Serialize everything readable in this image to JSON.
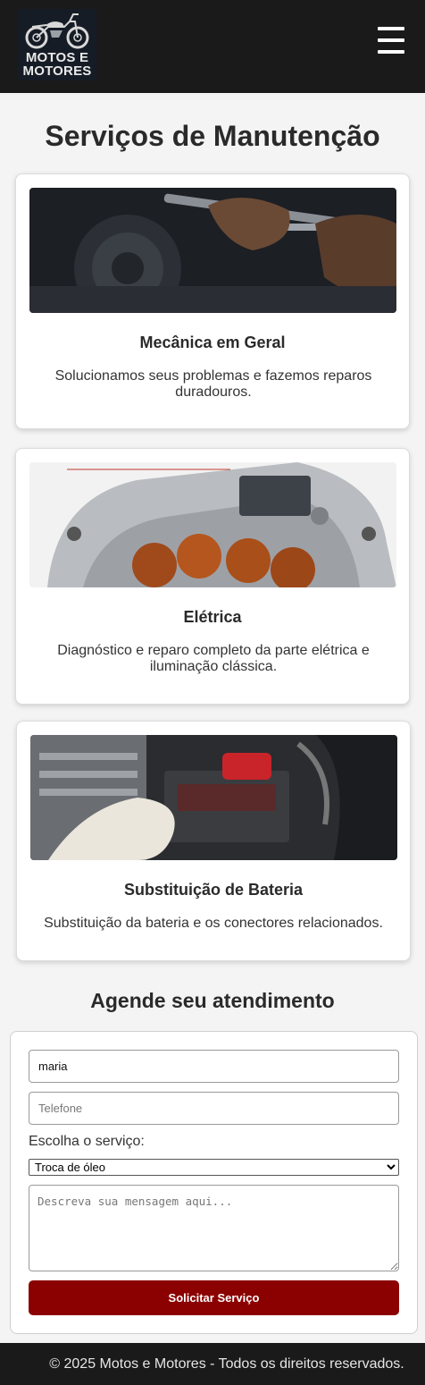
{
  "header": {
    "logo_text": "MOTOS E MOTORES",
    "menu_icon": "hamburger-icon"
  },
  "page_title": "Serviços de Manutenção",
  "services": [
    {
      "title": "Mecânica em Geral",
      "description": "Solucionamos seus problemas e fazemos reparos duradouros."
    },
    {
      "title": "Elétrica",
      "description": "Diagnóstico e reparo completo da parte elétrica e iluminação clássica."
    },
    {
      "title": "Substituição de Bateria",
      "description": "Substituição da bateria e os conectores relacionados."
    }
  ],
  "form": {
    "title": "Agende seu atendimento",
    "name_value": "maria",
    "phone_placeholder": "Telefone",
    "service_label": "Escolha o serviço:",
    "service_selected": "Troca de óleo",
    "message_placeholder": "Descreva sua mensagem aqui...",
    "submit_label": "Solicitar Serviço"
  },
  "footer": {
    "text": "© 2025 Motos e Motores - Todos os direitos reservados."
  },
  "colors": {
    "header_bg": "#1a1a1a",
    "accent": "#8b0000",
    "page_bg": "#f4f4f4"
  }
}
